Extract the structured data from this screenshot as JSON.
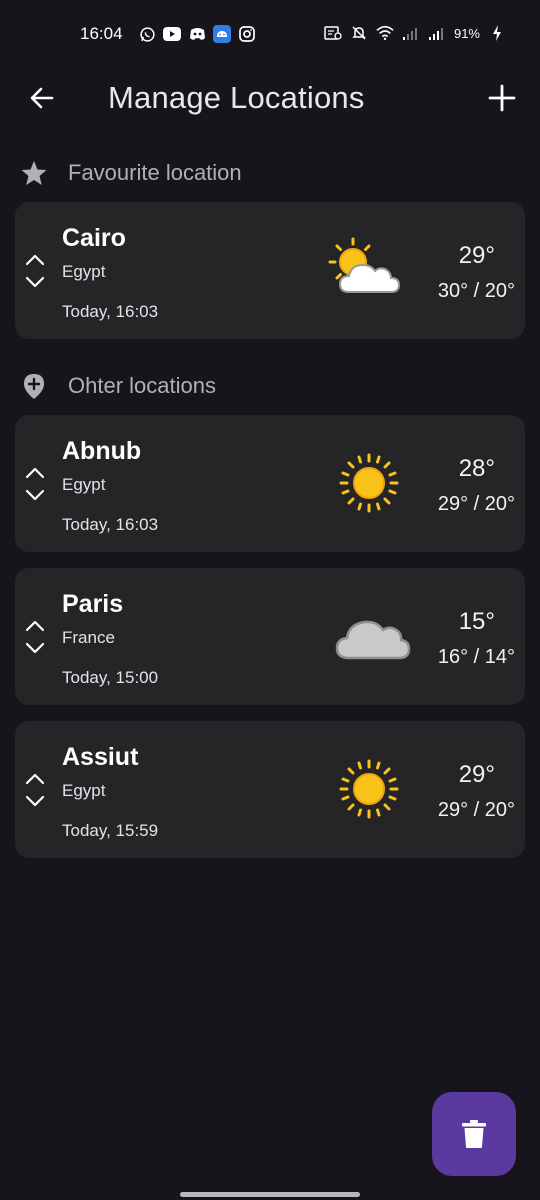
{
  "status_bar": {
    "time": "16:04",
    "battery": "91%",
    "icons_left": [
      "whatsapp-icon",
      "youtube-icon",
      "discord-icon",
      "android-icon",
      "instagram-icon"
    ],
    "icons_right": [
      "data-saver-icon",
      "bell-off-icon",
      "wifi-icon",
      "signal-icon",
      "signal-icon",
      "battery-charging-icon"
    ]
  },
  "app_bar": {
    "title": "Manage Locations",
    "back_icon": "arrow-left-icon",
    "add_icon": "plus-icon"
  },
  "favourite_section": {
    "label": "Favourite location",
    "icon": "star-icon"
  },
  "other_section": {
    "label": "Ohter locations",
    "icon": "location-plus-icon"
  },
  "locations": [
    {
      "city": "Cairo",
      "country": "Egypt",
      "updated": "Today, 16:03",
      "temp": "29°",
      "range": "30° / 20°",
      "condition_icon": "partly-cloudy-icon"
    },
    {
      "city": "Abnub",
      "country": "Egypt",
      "updated": "Today, 16:03",
      "temp": "28°",
      "range": "29° / 20°",
      "condition_icon": "sun-icon"
    },
    {
      "city": "Paris",
      "country": "France",
      "updated": "Today, 15:00",
      "temp": "15°",
      "range": "16° / 14°",
      "condition_icon": "cloud-icon"
    },
    {
      "city": "Assiut",
      "country": "Egypt",
      "updated": "Today, 15:59",
      "temp": "29°",
      "range": "29° / 20°",
      "condition_icon": "sun-icon"
    }
  ],
  "fab": {
    "icon": "trash-icon"
  },
  "colors": {
    "background": "#17141b",
    "card": "#252427",
    "fab": "#5b3aa0",
    "sun": "#f9c31a",
    "section_text": "#b3afb8"
  }
}
